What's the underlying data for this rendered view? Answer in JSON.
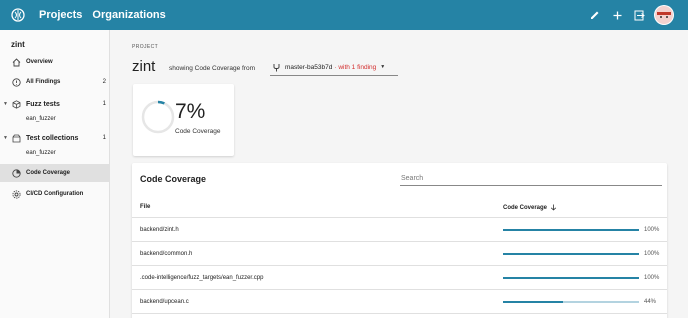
{
  "topbar": {
    "nav": [
      "Projects",
      "Organizations"
    ],
    "accent": "#2583a5"
  },
  "sidebar": {
    "project": "zint",
    "items": [
      {
        "label": "Overview",
        "icon": "home-icon"
      },
      {
        "label": "All Findings",
        "count": "2",
        "icon": "alert-circle-icon"
      },
      {
        "label": "Fuzz tests",
        "count": "1",
        "icon": "cube-icon"
      },
      {
        "label": "Test collections",
        "count": "1",
        "icon": "inbox-icon"
      },
      {
        "label": "Code Coverage",
        "icon": "coverage-icon"
      },
      {
        "label": "CI/CD Configuration",
        "icon": "gear-icon"
      }
    ],
    "fuzz_sub": "ean_fuzzer",
    "collection_sub": "ean_fuzzer"
  },
  "main": {
    "eyebrow": "PROJECT",
    "title": "zint",
    "showing": "showing Code Coverage from",
    "branch": "master-ba53b7d",
    "finding": "· with 1 finding",
    "coverage_pct": "7%",
    "coverage_value": 0.07,
    "coverage_label": "Code Coverage"
  },
  "table": {
    "title": "Code Coverage",
    "search_placeholder": "Search",
    "col_file": "File",
    "col_coverage": "Code Coverage",
    "rows": [
      {
        "file": "backend/zint.h",
        "pct": "100%",
        "value": 1.0
      },
      {
        "file": "backend/common.h",
        "pct": "100%",
        "value": 1.0
      },
      {
        "file": ".code-intelligence/fuzz_targets/ean_fuzzer.cpp",
        "pct": "100%",
        "value": 1.0
      },
      {
        "file": "backend/upcean.c",
        "pct": "44%",
        "value": 0.44
      }
    ]
  }
}
